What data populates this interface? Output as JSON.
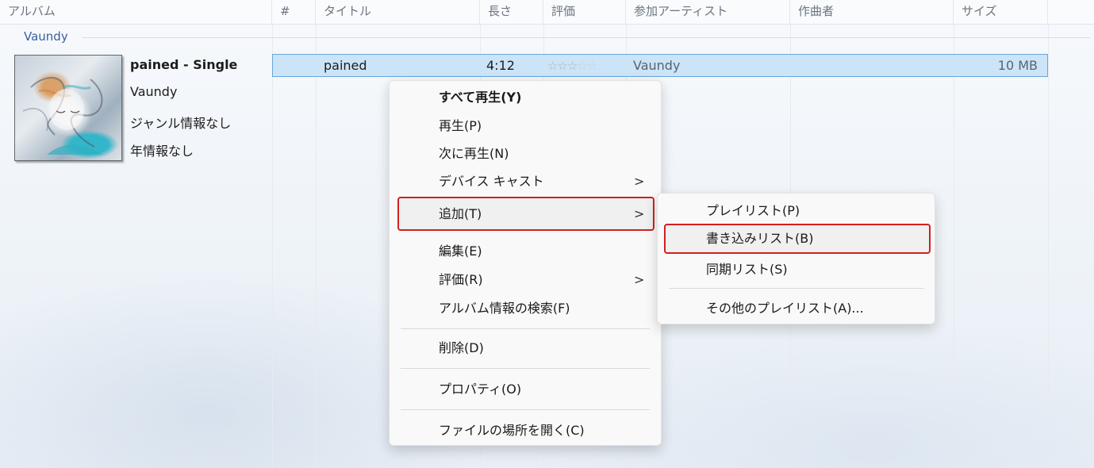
{
  "columns": [
    "アルバム",
    "#",
    "タイトル",
    "長さ",
    "評価",
    "参加アーティスト",
    "作曲者",
    "サイズ"
  ],
  "group_label": "Vaundy",
  "album": {
    "title": "pained - Single",
    "artist": "Vaundy",
    "genre": "ジャンル情報なし",
    "year": "年情報なし"
  },
  "track": {
    "title": "pained",
    "length": "4:12",
    "rating_stars": 3,
    "artist": "Vaundy",
    "size": "10 MB"
  },
  "context_menu": {
    "items": {
      "play_all": "すべて再生(Y)",
      "play": "再生(P)",
      "play_next": "次に再生(N)",
      "cast": "デバイス キャスト",
      "add": "追加(T)",
      "edit": "編集(E)",
      "rate": "評価(R)",
      "find_album_info": "アルバム情報の検索(F)",
      "delete": "削除(D)",
      "properties": "プロパティ(O)",
      "open_location": "ファイルの場所を開く(C)"
    },
    "arrow": ">"
  },
  "submenu": {
    "items": {
      "playlist": "プレイリスト(P)",
      "burn_list": "書き込みリスト(B)",
      "sync_list": "同期リスト(S)",
      "other_playlists": "その他のプレイリスト(A)..."
    }
  },
  "colors": {
    "selection": "#cce4f7",
    "highlight_border": "#d21f1f",
    "group_label": "#3a5fa0"
  }
}
